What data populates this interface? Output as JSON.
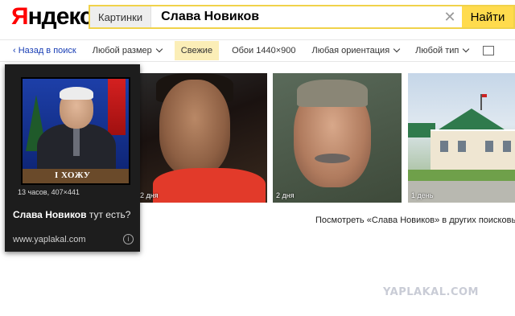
{
  "header": {
    "logo": "Яндекс",
    "logo_first": "Я",
    "logo_rest": "ндекс",
    "service_chip": "Картинки",
    "query": "Слава Новиков",
    "clear_glyph": "✕",
    "submit_label": "Найти"
  },
  "filters": {
    "back_label": "‹ Назад в поиск",
    "size_label": "Любой размер",
    "fresh_label": "Свежие",
    "wallpaper_label": "Обои 1440×900",
    "orientation_label": "Любая ориентация",
    "type_label": "Любой тип"
  },
  "popup": {
    "caption": "I ХОЖУ",
    "dims": "13 часов, 407×441",
    "title_bold": "Слава Новиков",
    "title_rest": " тут есть?",
    "site": "www.yaplakal.com",
    "info_glyph": "i"
  },
  "tiles": [
    {
      "age": "2 дня"
    },
    {
      "age": "2 дня"
    },
    {
      "age": "1 день"
    }
  ],
  "more_link": "Посмотреть «Слава Новиков» в других поисковых",
  "watermark": "YAPLAKAL.COM",
  "colors": {
    "accent_yellow": "#ffdb4d",
    "search_border": "#f0d24a",
    "logo_red": "#ff0000",
    "link_blue": "#1a3fb5",
    "popup_bg": "#1d1d1d"
  }
}
